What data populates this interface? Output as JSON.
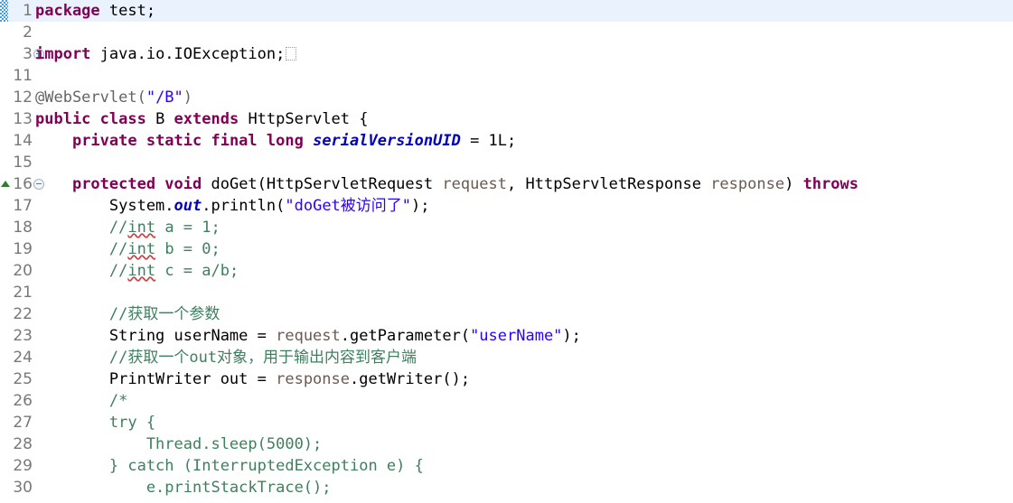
{
  "editor": {
    "name": "java-source-editor",
    "font_size_px": 17,
    "line_height_px": 24,
    "colors": {
      "background": "#ffffff",
      "current_line_highlight": "#eaf2fd",
      "keyword": "#7f0055",
      "string": "#2a00ff",
      "comment": "#3f7f5f",
      "annotation": "#646464",
      "static_field": "#0000c0",
      "parameter": "#6a5a52",
      "line_number": "#787878",
      "change_bar": "#3c9fe0",
      "override_marker": "#2e7d32",
      "spell_underline": "#d04040"
    }
  },
  "lines": [
    {
      "number": "1",
      "highlight": true,
      "change_bar": true,
      "fold": null,
      "override": false,
      "tokens": [
        {
          "t": "package",
          "c": "kw"
        },
        {
          "t": " test;",
          "c": "plain"
        }
      ],
      "plain_text": "package test;"
    },
    {
      "number": "2",
      "highlight": false,
      "change_bar": false,
      "fold": null,
      "override": false,
      "tokens": [],
      "plain_text": ""
    },
    {
      "number": "3",
      "highlight": false,
      "change_bar": false,
      "fold": "plus",
      "override": false,
      "tokens": [
        {
          "t": "import",
          "c": "kw"
        },
        {
          "t": " java.io.IOException;",
          "c": "plain"
        },
        {
          "t": "",
          "c": "collapsebox"
        }
      ],
      "plain_text": "import java.io.IOException;"
    },
    {
      "number": "11",
      "highlight": false,
      "change_bar": false,
      "fold": null,
      "override": false,
      "tokens": [],
      "plain_text": ""
    },
    {
      "number": "12",
      "highlight": false,
      "change_bar": false,
      "fold": null,
      "override": false,
      "tokens": [
        {
          "t": "@WebServlet(",
          "c": "anno"
        },
        {
          "t": "\"/B\"",
          "c": "str"
        },
        {
          "t": ")",
          "c": "anno"
        }
      ],
      "plain_text": "@WebServlet(\"/B\")"
    },
    {
      "number": "13",
      "highlight": false,
      "change_bar": false,
      "fold": null,
      "override": false,
      "tokens": [
        {
          "t": "public class",
          "c": "kw"
        },
        {
          "t": " B ",
          "c": "plain"
        },
        {
          "t": "extends",
          "c": "kw"
        },
        {
          "t": " HttpServlet {",
          "c": "plain"
        }
      ],
      "plain_text": "public class B extends HttpServlet {"
    },
    {
      "number": "14",
      "highlight": false,
      "change_bar": false,
      "fold": null,
      "override": false,
      "tokens": [
        {
          "t": "    ",
          "c": "plain"
        },
        {
          "t": "private static final long",
          "c": "kw"
        },
        {
          "t": " ",
          "c": "plain"
        },
        {
          "t": "serialVersionUID",
          "c": "field"
        },
        {
          "t": " = 1L;",
          "c": "plain"
        }
      ],
      "plain_text": "    private static final long serialVersionUID = 1L;"
    },
    {
      "number": "15",
      "highlight": false,
      "change_bar": false,
      "fold": null,
      "override": false,
      "tokens": [],
      "plain_text": ""
    },
    {
      "number": "16",
      "highlight": false,
      "change_bar": false,
      "fold": "minus",
      "override": true,
      "tokens": [
        {
          "t": "    ",
          "c": "plain"
        },
        {
          "t": "protected void",
          "c": "kw"
        },
        {
          "t": " doGet(HttpServletRequest ",
          "c": "plain"
        },
        {
          "t": "request",
          "c": "param"
        },
        {
          "t": ", HttpServletResponse ",
          "c": "plain"
        },
        {
          "t": "response",
          "c": "param"
        },
        {
          "t": ") ",
          "c": "plain"
        },
        {
          "t": "throws",
          "c": "kw"
        }
      ],
      "plain_text": "    protected void doGet(HttpServletRequest request, HttpServletResponse response) throws"
    },
    {
      "number": "17",
      "highlight": false,
      "change_bar": false,
      "fold": null,
      "override": false,
      "tokens": [
        {
          "t": "        System.",
          "c": "plain"
        },
        {
          "t": "out",
          "c": "field"
        },
        {
          "t": ".println(",
          "c": "plain"
        },
        {
          "t": "\"doGet被访问了\"",
          "c": "str"
        },
        {
          "t": ");",
          "c": "plain"
        }
      ],
      "plain_text": "        System.out.println(\"doGet被访问了\");"
    },
    {
      "number": "18",
      "highlight": false,
      "change_bar": false,
      "fold": null,
      "override": false,
      "tokens": [
        {
          "t": "        //",
          "c": "cmt"
        },
        {
          "t": "int",
          "c": "cmt spell"
        },
        {
          "t": " a = 1;",
          "c": "cmt"
        }
      ],
      "plain_text": "        //int a = 1;"
    },
    {
      "number": "19",
      "highlight": false,
      "change_bar": false,
      "fold": null,
      "override": false,
      "tokens": [
        {
          "t": "        //",
          "c": "cmt"
        },
        {
          "t": "int",
          "c": "cmt spell"
        },
        {
          "t": " b = 0;",
          "c": "cmt"
        }
      ],
      "plain_text": "        //int b = 0;"
    },
    {
      "number": "20",
      "highlight": false,
      "change_bar": false,
      "fold": null,
      "override": false,
      "tokens": [
        {
          "t": "        //",
          "c": "cmt"
        },
        {
          "t": "int",
          "c": "cmt spell"
        },
        {
          "t": " c = a/b;",
          "c": "cmt"
        }
      ],
      "plain_text": "        //int c = a/b;"
    },
    {
      "number": "21",
      "highlight": false,
      "change_bar": false,
      "fold": null,
      "override": false,
      "tokens": [],
      "plain_text": ""
    },
    {
      "number": "22",
      "highlight": false,
      "change_bar": false,
      "fold": null,
      "override": false,
      "tokens": [
        {
          "t": "        //获取一个参数",
          "c": "cmt"
        }
      ],
      "plain_text": "        //获取一个参数"
    },
    {
      "number": "23",
      "highlight": false,
      "change_bar": false,
      "fold": null,
      "override": false,
      "tokens": [
        {
          "t": "        String userName = ",
          "c": "plain"
        },
        {
          "t": "request",
          "c": "param"
        },
        {
          "t": ".getParameter(",
          "c": "plain"
        },
        {
          "t": "\"userName\"",
          "c": "str"
        },
        {
          "t": ");",
          "c": "plain"
        }
      ],
      "plain_text": "        String userName = request.getParameter(\"userName\");"
    },
    {
      "number": "24",
      "highlight": false,
      "change_bar": false,
      "fold": null,
      "override": false,
      "tokens": [
        {
          "t": "        //获取一个out对象，用于输出内容到客户端",
          "c": "cmt"
        }
      ],
      "plain_text": "        //获取一个out对象，用于输出内容到客户端"
    },
    {
      "number": "25",
      "highlight": false,
      "change_bar": false,
      "fold": null,
      "override": false,
      "tokens": [
        {
          "t": "        PrintWriter out = ",
          "c": "plain"
        },
        {
          "t": "response",
          "c": "param"
        },
        {
          "t": ".getWriter();",
          "c": "plain"
        }
      ],
      "plain_text": "        PrintWriter out = response.getWriter();"
    },
    {
      "number": "26",
      "highlight": false,
      "change_bar": false,
      "fold": null,
      "override": false,
      "tokens": [
        {
          "t": "        /*",
          "c": "cmt"
        }
      ],
      "plain_text": "        /*"
    },
    {
      "number": "27",
      "highlight": false,
      "change_bar": false,
      "fold": null,
      "override": false,
      "tokens": [
        {
          "t": "        try {",
          "c": "cmt"
        }
      ],
      "plain_text": "        try {"
    },
    {
      "number": "28",
      "highlight": false,
      "change_bar": false,
      "fold": null,
      "override": false,
      "tokens": [
        {
          "t": "            Thread.sleep(5000);",
          "c": "cmt"
        }
      ],
      "plain_text": "            Thread.sleep(5000);"
    },
    {
      "number": "29",
      "highlight": false,
      "change_bar": false,
      "fold": null,
      "override": false,
      "tokens": [
        {
          "t": "        } catch (InterruptedException e) {",
          "c": "cmt"
        }
      ],
      "plain_text": "        } catch (InterruptedException e) {"
    },
    {
      "number": "30",
      "highlight": false,
      "change_bar": false,
      "fold": null,
      "override": false,
      "tokens": [
        {
          "t": "            e.printStackTrace();",
          "c": "cmt"
        }
      ],
      "plain_text": "            e.printStackTrace();"
    }
  ]
}
